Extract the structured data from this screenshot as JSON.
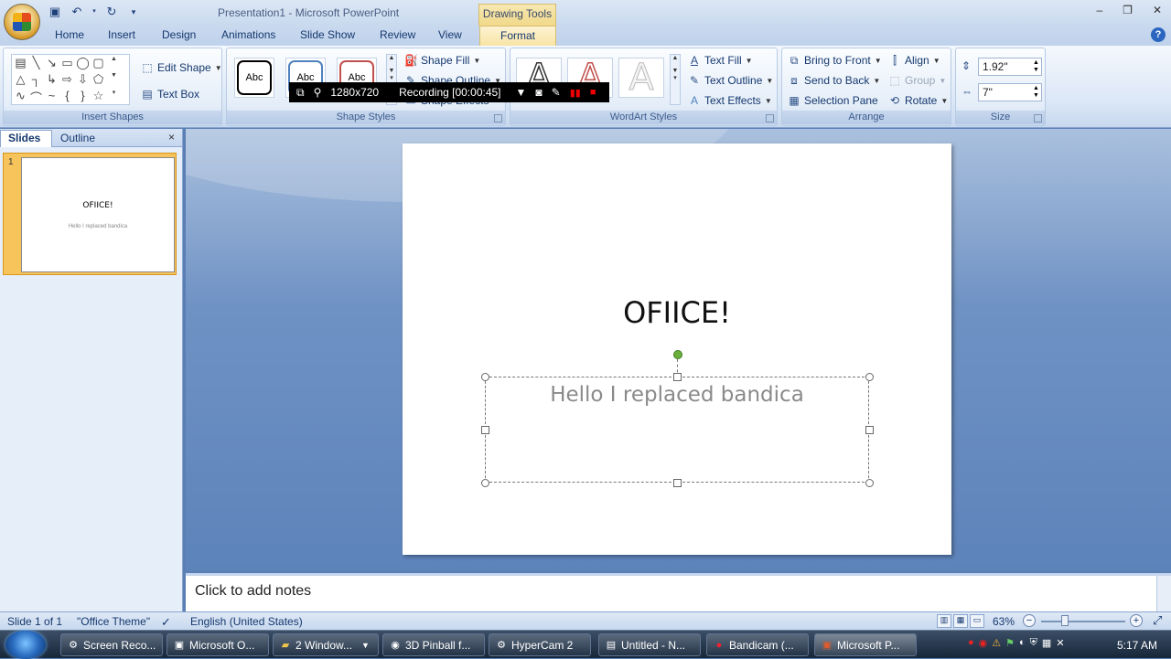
{
  "window": {
    "title": "Presentation1 - Microsoft PowerPoint",
    "contextual_group": "Drawing Tools"
  },
  "ribbon": {
    "tabs": [
      "Home",
      "Insert",
      "Design",
      "Animations",
      "Slide Show",
      "Review",
      "View",
      "Format"
    ],
    "active_tab": "Format",
    "insert_shapes": {
      "label": "Insert Shapes",
      "edit_shape": "Edit Shape",
      "text_box": "Text Box"
    },
    "shape_styles": {
      "label": "Shape Styles",
      "thumb_text": "Abc",
      "shape_fill": "Shape Fill",
      "shape_outline": "Shape Outline",
      "shape_effects": "Shape Effects"
    },
    "wordart_styles": {
      "label": "WordArt Styles",
      "thumb_letter": "A",
      "text_fill": "Text Fill",
      "text_outline": "Text Outline",
      "text_effects": "Text Effects"
    },
    "arrange": {
      "label": "Arrange",
      "bring_to_front": "Bring to Front",
      "send_to_back": "Send to Back",
      "selection_pane": "Selection Pane",
      "align": "Align",
      "group": "Group",
      "rotate": "Rotate"
    },
    "size": {
      "label": "Size",
      "height": "1.92\"",
      "width": "7\""
    }
  },
  "recording_overlay": {
    "resolution": "1280x720",
    "status": "Recording [00:00:45]"
  },
  "left_pane": {
    "tab_slides": "Slides",
    "tab_outline": "Outline",
    "close": "×",
    "slide_number": "1",
    "thumb_title": "OFIICE!",
    "thumb_subtitle": "Hello I replaced bandica"
  },
  "slide": {
    "title": "OFIICE!",
    "subtitle": "Hello I replaced bandica"
  },
  "notes": {
    "placeholder": "Click to add notes"
  },
  "status_bar": {
    "slide_info": "Slide 1 of 1",
    "theme": "\"Office Theme\"",
    "language": "English (United States)",
    "zoom": "63%"
  },
  "taskbar": {
    "items": [
      "Screen Reco...",
      "Microsoft O...",
      "2 Window...",
      "3D Pinball f...",
      "HyperCam 2",
      "Untitled - N...",
      "Bandicam (...",
      "Microsoft P..."
    ],
    "clock": "5:17 AM"
  }
}
